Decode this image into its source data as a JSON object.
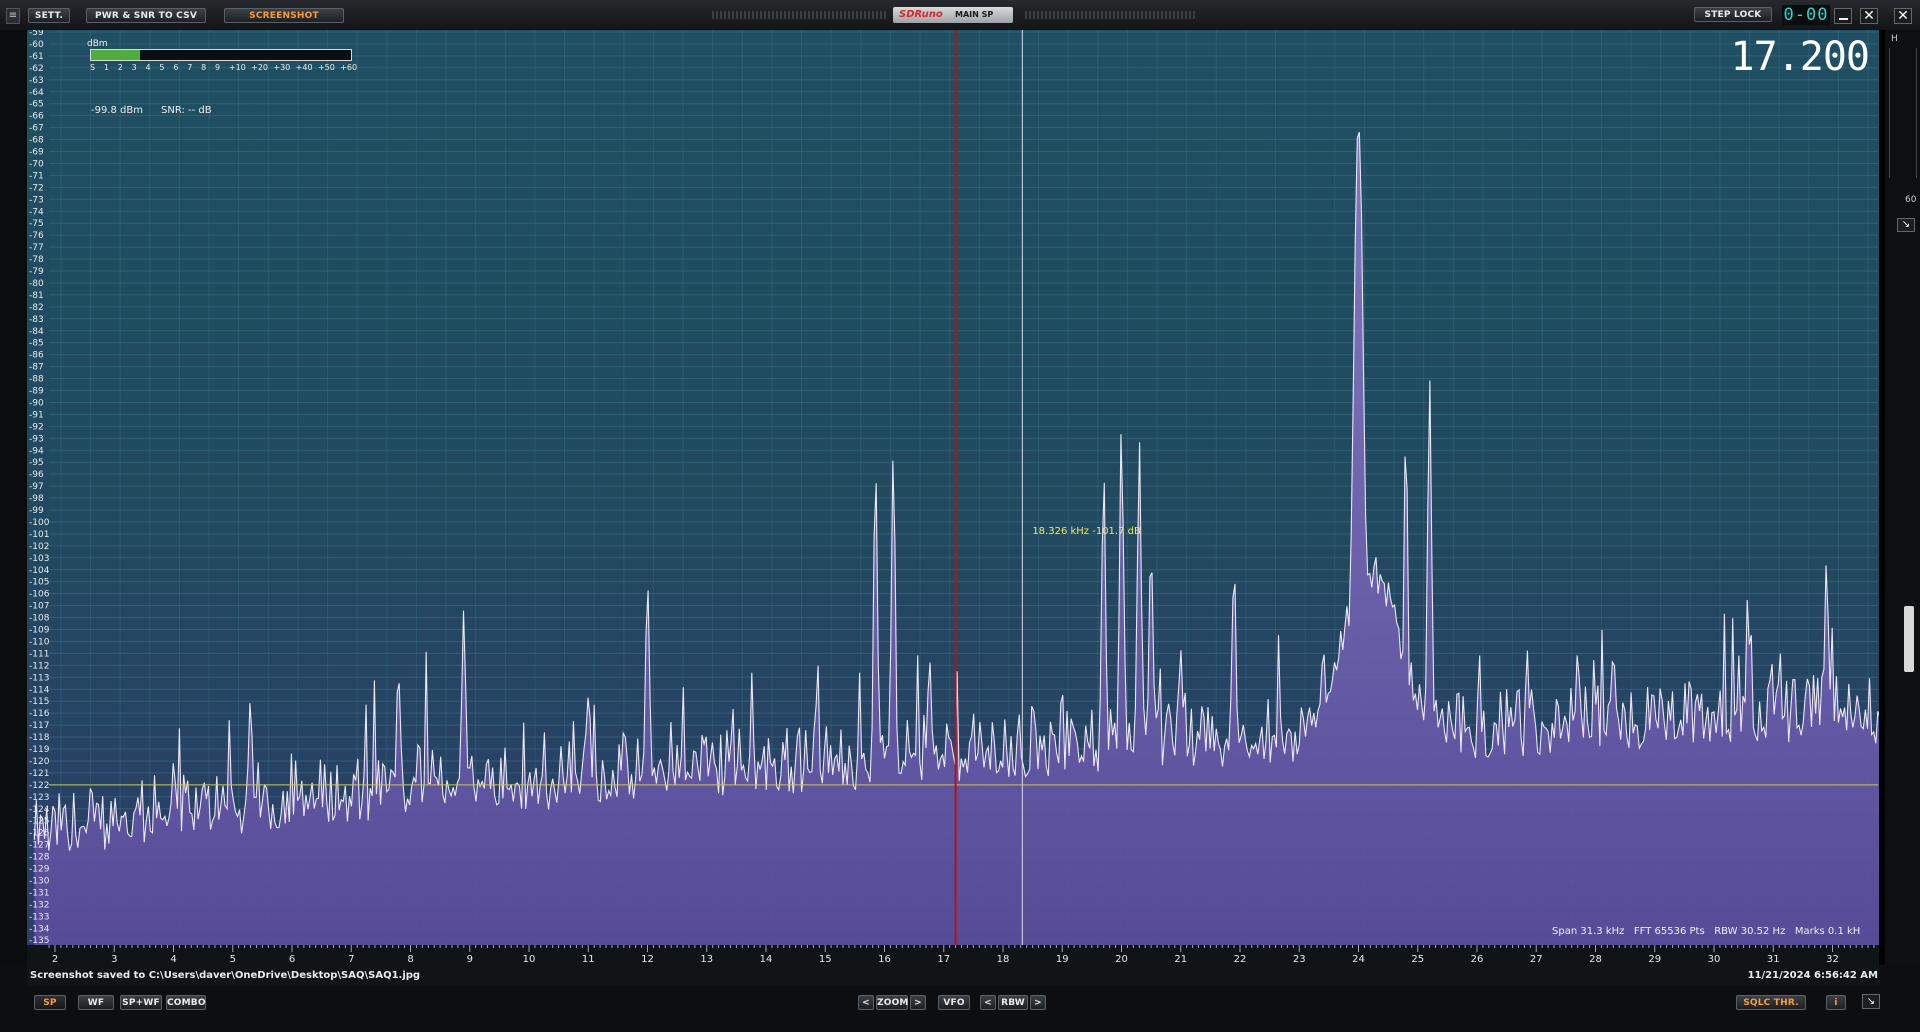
{
  "toolbar": {
    "sett_label": "SETT.",
    "csv_label": "PWR & SNR TO CSV",
    "screenshot_label": "SCREENSHOT",
    "brand": "SDRuno",
    "window_title": "MAIN SP",
    "steplock_label": "STEP LOCK",
    "digital_readout": "0-00"
  },
  "meter": {
    "unit": "dBm",
    "scale": [
      "S",
      "1",
      "2",
      "3",
      "4",
      "5",
      "6",
      "7",
      "8",
      "9",
      "+10",
      "+20",
      "+30",
      "+40",
      "+50",
      "+60"
    ],
    "level_fraction": 0.19,
    "power": "-99.8 dBm",
    "snr": "SNR: -- dB"
  },
  "frequency": "17.200",
  "marker": {
    "label": "18.326 kHz -101.7 dB"
  },
  "info": {
    "span": "Span 31.3 kHz",
    "fft": "FFT 65536 Pts",
    "rbw": "RBW 30.52 Hz",
    "marks": "Marks 0.1 kH"
  },
  "status": {
    "message": "Screenshot saved to C:\\Users\\daver\\OneDrive\\Desktop\\SAQ\\SAQ1.jpg",
    "timestamp": "11/21/2024 6:56:42 AM"
  },
  "bottom": {
    "sp": "SP",
    "wf": "WF",
    "spwf": "SP+WF",
    "combo": "COMBO",
    "zoom": "ZOOM",
    "vfo": "VFO",
    "rbw": "RBW",
    "sqlc": "SQLC THR.",
    "info": "i",
    "prev": "<",
    "next": ">"
  },
  "right_panel": {
    "top_letter": "H",
    "value": "60"
  },
  "colors": {
    "accent_orange": "#ff9a33",
    "brand_red": "#e03030",
    "squelch_line": "#c8c84a",
    "vfo_line": "#b01515",
    "spectrum_fill": "#6a5aa8",
    "trace": "#e8e4f4",
    "marker_text": "#f2e85a",
    "meter_green": "#4fae3a"
  },
  "chart_data": {
    "type": "area",
    "title": "",
    "xlabel": "",
    "ylabel": "",
    "x_unit": "kHz",
    "xlim": [
      1.6,
      32.9
    ],
    "ylim": [
      -135.5,
      -59
    ],
    "y_ticks_from": -59,
    "y_ticks_to": -135,
    "x_ticks": [
      2,
      3,
      4,
      5,
      6,
      7,
      8,
      9,
      10,
      11,
      12,
      13,
      14,
      15,
      16,
      17,
      18,
      19,
      20,
      21,
      22,
      23,
      24,
      25,
      26,
      27,
      28,
      29,
      30,
      31,
      32
    ],
    "noise_floor_start": -128,
    "noise_floor_end": -117,
    "squelch_level": -122,
    "vfo_frequency": 17.2,
    "marker_frequency": 18.326,
    "series": [
      {
        "peaks": [
          {
            "f": 4.0,
            "db": -121
          },
          {
            "f": 5.3,
            "db": -115
          },
          {
            "f": 7.8,
            "db": -112
          },
          {
            "f": 8.9,
            "db": -107
          },
          {
            "f": 11.0,
            "db": -114
          },
          {
            "f": 12.0,
            "db": -104
          },
          {
            "f": 15.85,
            "db": -95
          },
          {
            "f": 16.15,
            "db": -94.5
          },
          {
            "f": 19.7,
            "db": -95
          },
          {
            "f": 20.0,
            "db": -92
          },
          {
            "f": 20.3,
            "db": -93
          },
          {
            "f": 20.5,
            "db": -102
          },
          {
            "f": 21.0,
            "db": -110
          },
          {
            "f": 21.9,
            "db": -103
          },
          {
            "f": 23.4,
            "db": -110
          },
          {
            "f": 24.0,
            "db": -67
          },
          {
            "f": 24.8,
            "db": -92
          },
          {
            "f": 25.2,
            "db": -87
          },
          {
            "f": 27.7,
            "db": -110
          },
          {
            "f": 28.3,
            "db": -111
          },
          {
            "f": 31.9,
            "db": -104
          }
        ]
      }
    ]
  }
}
